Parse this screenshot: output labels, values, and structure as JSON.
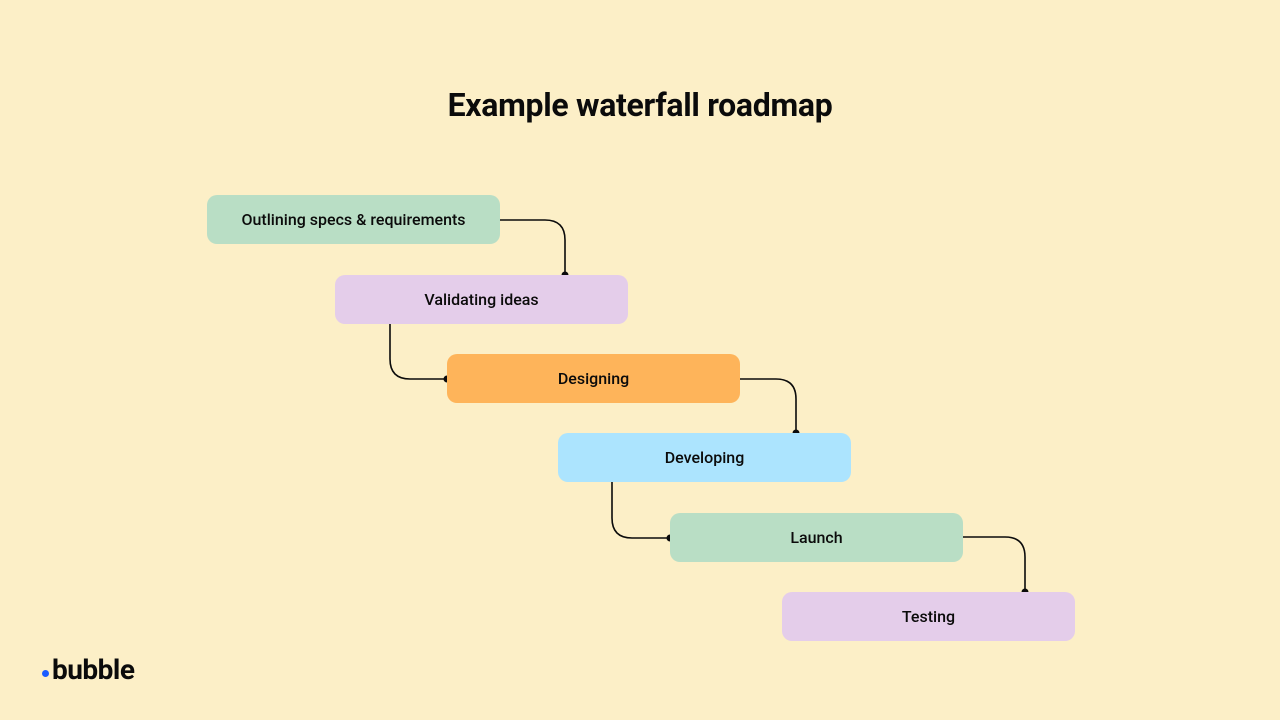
{
  "title": "Example waterfall roadmap",
  "stages": {
    "s0": "Outlining specs & requirements",
    "s1": "Validating ideas",
    "s2": "Designing",
    "s3": "Developing",
    "s4": "Launch",
    "s5": "Testing"
  },
  "logo": {
    "text": "bubble"
  },
  "colors": {
    "background": "#fcefc7",
    "green": "#b9dec5",
    "lilac": "#e4cdea",
    "orange": "#feb45a",
    "blue": "#ace4fe"
  }
}
